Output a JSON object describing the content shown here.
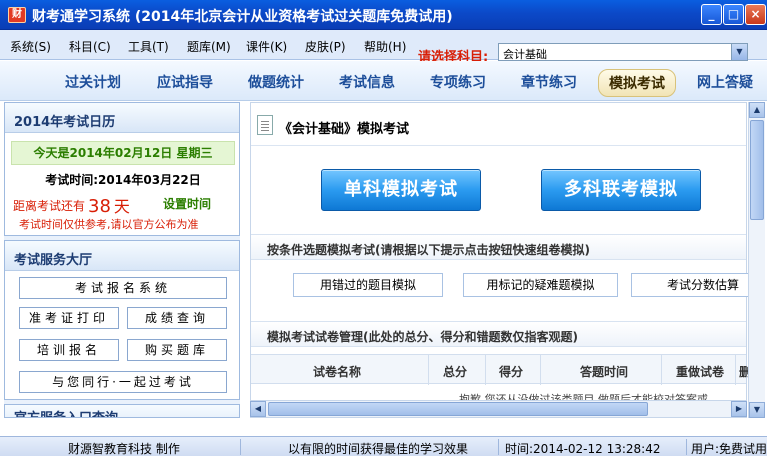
{
  "window": {
    "title": "财考通学习系统 (2014年北京会计从业资格考试过关题库免费试用)",
    "minimize": "_",
    "maximize": "□",
    "close": "×"
  },
  "menu": {
    "items": [
      "系统(S)",
      "科目(C)",
      "工具(T)",
      "题库(M)",
      "课件(K)",
      "皮肤(P)",
      "帮助(H)"
    ],
    "subject_label": "请选择科目:",
    "subject_value": "会计基础"
  },
  "tabs": [
    "过关计划",
    "应试指导",
    "做题统计",
    "考试信息",
    "专项练习",
    "章节练习",
    "模拟考试",
    "网上答疑"
  ],
  "active_tab": "模拟考试",
  "calendar": {
    "title": "2014年考试日历",
    "today": "今天是2014年02月12日 星期三",
    "exam_time": "考试时间:2014年03月22日",
    "countdown_prefix": "距离考试还有",
    "countdown_days": "38",
    "countdown_suffix": "天",
    "set_time": "设置时间",
    "notice": "考试时间仅供参考,请以官方公布为准"
  },
  "service": {
    "title": "考试服务大厅",
    "buttons": {
      "registration_system": "考试报名系统",
      "admission_print": "准考证打印",
      "score_query": "成绩查询",
      "training_signup": "培训报名",
      "buy_bank": "购买题库",
      "study_together": "与您同行·一起过考试"
    },
    "next_title": "官方服务入口查询"
  },
  "main": {
    "title": "《会计基础》模拟考试",
    "single_exam": "单科模拟考试",
    "multi_exam": "多科联考模拟",
    "filter_section": "按条件选题模拟考试(请根据以下提示点击按钮快速组卷模拟)",
    "filter_buttons": [
      "用错过的题目模拟",
      "用标记的疑难题模拟",
      "考试分数估算"
    ],
    "manage_section": "模拟考试试卷管理(此处的总分、得分和错题数仅指客观题)",
    "table_headers": [
      "试卷名称",
      "总分",
      "得分",
      "答题时间",
      "重做试卷",
      "删"
    ],
    "empty_message": "抱歉,您还从没做过该类题目,做题后才能校对答案或"
  },
  "status": {
    "company": "财源智教育科技 制作",
    "slogan": "以有限的时间获得最佳的学习效果",
    "time": "时间:2014-02-12 13:28:42",
    "user": "用户:免费试用"
  }
}
